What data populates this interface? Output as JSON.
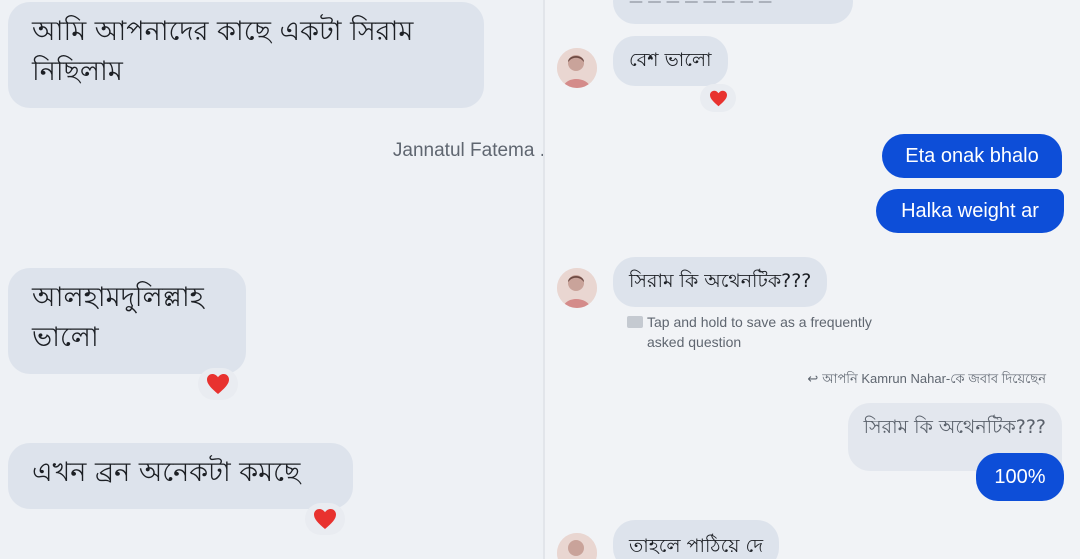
{
  "left": {
    "messages": [
      {
        "text": "আমি আপনাদের কাছে একটা সিরাম নিছিলাম"
      },
      {
        "text": "আলহামদুলিল্লাহ ভালো",
        "reaction": "heart"
      },
      {
        "text": "এখন ব্রন অনেকটা কমছে",
        "reaction": "heart"
      }
    ],
    "sender_name": "Jannatul Fatema ."
  },
  "right": {
    "top_partial": "— — — — — — — —",
    "msg1": {
      "text": "বেশ ভালো",
      "reaction": "heart"
    },
    "out1": "Eta onak bhalo",
    "out2": "Halka weight ar",
    "msg2": {
      "text": "সিরাম কি অথেনটিক???"
    },
    "faq_hint_line1": "Tap and hold to save as a frequently",
    "faq_hint_line2": "asked question",
    "reply_notice": "আপনি Kamrun Nahar-কে জবাব দিয়েছেন",
    "quoted": "সিরাম কি অথেনটিক???",
    "out3": "100%",
    "bottom_partial": "তাহলে পাঠিয়ে দে"
  },
  "colors": {
    "outgoing": "#0d4ed8",
    "incoming": "#dde3ec",
    "heart": "#e8322f"
  }
}
